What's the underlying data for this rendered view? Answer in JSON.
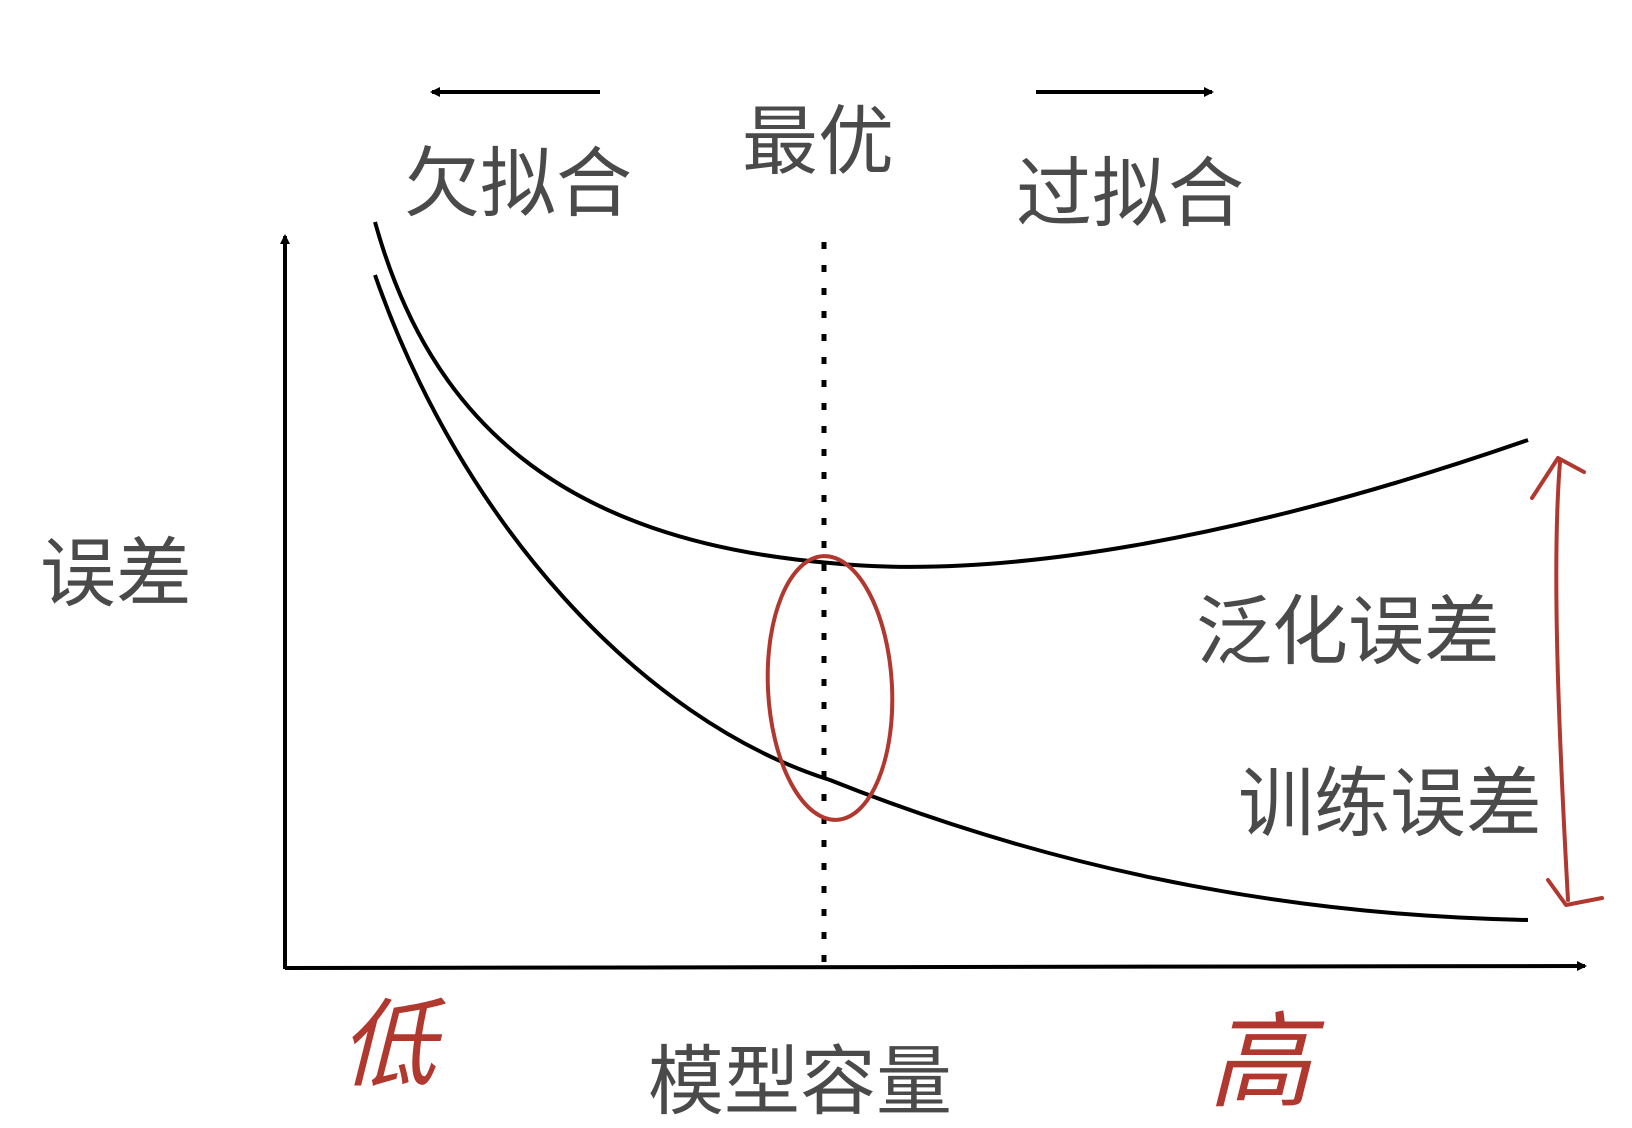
{
  "labels": {
    "underfit": "欠拟合",
    "optimal": "最优",
    "overfit": "过拟合",
    "y_axis": "误差",
    "x_axis": "模型容量",
    "generalization_error": "泛化误差",
    "training_error": "训练误差"
  },
  "handwritten": {
    "low": "低",
    "high": "高"
  },
  "colors": {
    "curve": "#000000",
    "text": "#4a4a4a",
    "handwriting": "#b0382e"
  }
}
